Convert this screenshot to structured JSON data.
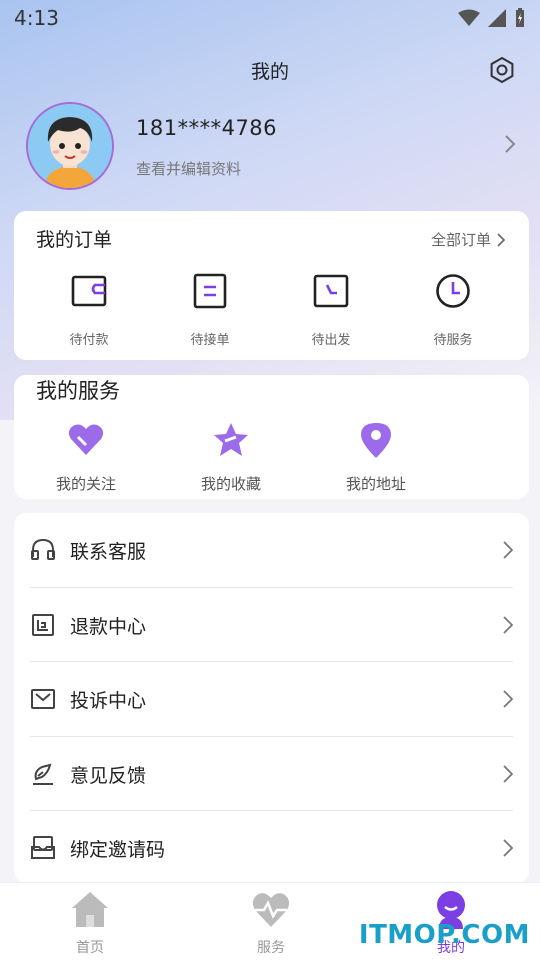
{
  "status_bar": {
    "time": "4:13"
  },
  "header": {
    "title": "我的",
    "settings_icon": "settings-gear-icon"
  },
  "profile": {
    "phone": "181****4786",
    "edit_link": "查看并编辑资料"
  },
  "orders": {
    "title": "我的订单",
    "all_link": "全部订单",
    "items": [
      {
        "label": "待付款",
        "icon": "wallet-icon"
      },
      {
        "label": "待接单",
        "icon": "clipboard-icon"
      },
      {
        "label": "待出发",
        "icon": "depart-icon"
      },
      {
        "label": "待服务",
        "icon": "clock-icon"
      }
    ]
  },
  "services": {
    "title": "我的服务",
    "items": [
      {
        "label": "我的关注",
        "icon": "heart-icon"
      },
      {
        "label": "我的收藏",
        "icon": "star-icon"
      },
      {
        "label": "我的地址",
        "icon": "location-pin-icon"
      }
    ]
  },
  "menu": {
    "items": [
      {
        "label": "联系客服",
        "icon": "headset-icon"
      },
      {
        "label": "退款中心",
        "icon": "refund-icon"
      },
      {
        "label": "投诉中心",
        "icon": "envelope-icon"
      },
      {
        "label": "意见反馈",
        "icon": "feedback-pen-icon"
      },
      {
        "label": "绑定邀请码",
        "icon": "invite-box-icon"
      }
    ]
  },
  "tabbar": {
    "items": [
      {
        "label": "首页",
        "icon": "home-icon"
      },
      {
        "label": "服务",
        "icon": "heartbeat-icon"
      },
      {
        "label": "我的",
        "icon": "user-icon"
      }
    ],
    "active": "我的"
  },
  "watermark": "ITMOP.COM",
  "colors": {
    "accent": "#7b3fe4",
    "brand_purple": "#8f5ee8"
  }
}
